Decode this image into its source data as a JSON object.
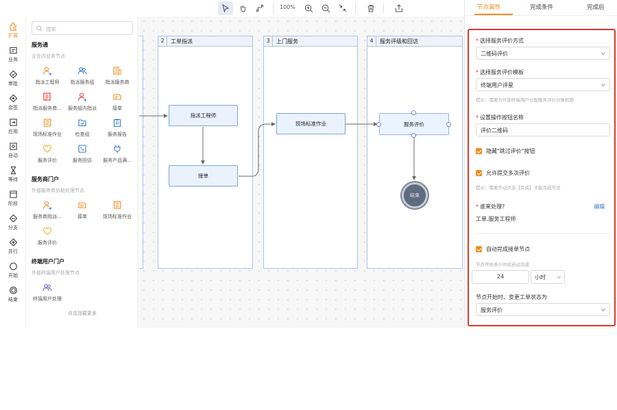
{
  "toolbar": {
    "zoom": "100%",
    "tools": [
      "select-arrow-icon",
      "hand-icon",
      "connector-icon",
      "zoom-in-icon",
      "zoom-out-icon",
      "fit-icon",
      "delete-icon",
      "export-icon"
    ]
  },
  "rail": {
    "items": [
      {
        "label": "扩展",
        "icon": "puzzle-icon",
        "active": true
      },
      {
        "label": "业务",
        "icon": "card-icon"
      },
      {
        "label": "审批",
        "icon": "approve-icon"
      },
      {
        "label": "会签",
        "icon": "cosign-icon"
      },
      {
        "label": "应用",
        "icon": "app-icon"
      },
      {
        "label": "自动",
        "icon": "auto-icon"
      },
      {
        "label": "等待",
        "icon": "hourglass-icon"
      },
      {
        "label": "阶段",
        "icon": "stage-icon"
      },
      {
        "label": "分支",
        "icon": "branch-icon"
      },
      {
        "label": "并行",
        "icon": "parallel-icon"
      },
      {
        "label": "开始",
        "icon": "start-icon"
      },
      {
        "label": "结束",
        "icon": "end-icon"
      }
    ]
  },
  "nodepanel": {
    "search_placeholder": "搜索",
    "groups": [
      {
        "title": "服务通",
        "subtitle": "企业内业务节点",
        "items": [
          "指派工程师",
          "指派服务组",
          "指派服务商",
          "指派服务商...",
          "服务组内指派",
          "接单",
          "现场标准作业",
          "检查组",
          "服务报告",
          "服务评价",
          "服务回访",
          "服务产品满..."
        ]
      },
      {
        "title": "服务商门户",
        "subtitle": "外部服务商协助处理节点",
        "items": [
          "服务商指派...",
          "接单",
          "现场标准作业",
          "服务评价"
        ]
      },
      {
        "title": "终端用户门户",
        "subtitle": "外部终端用户处理节点",
        "items": [
          "终端用户处理"
        ]
      }
    ],
    "load_more": "点击加载更多"
  },
  "canvas": {
    "lanes": [
      {
        "num": "2",
        "title": "工单指派"
      },
      {
        "num": "3",
        "title": "上门服务"
      },
      {
        "num": "4",
        "title": "服务评级和回访"
      }
    ],
    "nodes": {
      "assign_engineer": "指派工程师",
      "accept_order": "接单",
      "onsite_work": "现场标准作业",
      "service_eval": "服务评价",
      "end": "结束"
    }
  },
  "rightpanel": {
    "tabs": [
      "节点属性",
      "完成条件",
      "完成后"
    ],
    "active_tab": 0,
    "eval_method_label": "选择服务评价方式",
    "eval_method_value": "二维码评价",
    "eval_template_label": "选择服务评价模板",
    "eval_template_value": "终端用户评星",
    "eval_template_hint": "提示：需要为外部终端用户分配服务评价对象权限",
    "button_name_label": "设置操作按钮名称",
    "button_name_value": "评价二维码",
    "hide_skip_label": "隐藏\"跳过评价\"按钮",
    "allow_multi_label": "允许提交多次评价",
    "allow_multi_hint": "提示：需要手动点击【完成】才能完成节点",
    "who_handles_label": "谁来处理?",
    "edit_link": "编辑",
    "who_handles_value": "工单.服务工程师",
    "auto_complete_label": "自动完成接单节点",
    "auto_complete_hint": "节点开始多少时间自动完成",
    "auto_complete_num": "24",
    "auto_complete_unit": "小时",
    "status_label": "节点开始时，变更工单状态为",
    "status_value": "服务评价"
  },
  "colors": {
    "accent": "#f08c1e",
    "highlight_frame": "#e0362c",
    "node_border": "#7ea6d6",
    "lane_border": "#aec4e0"
  }
}
